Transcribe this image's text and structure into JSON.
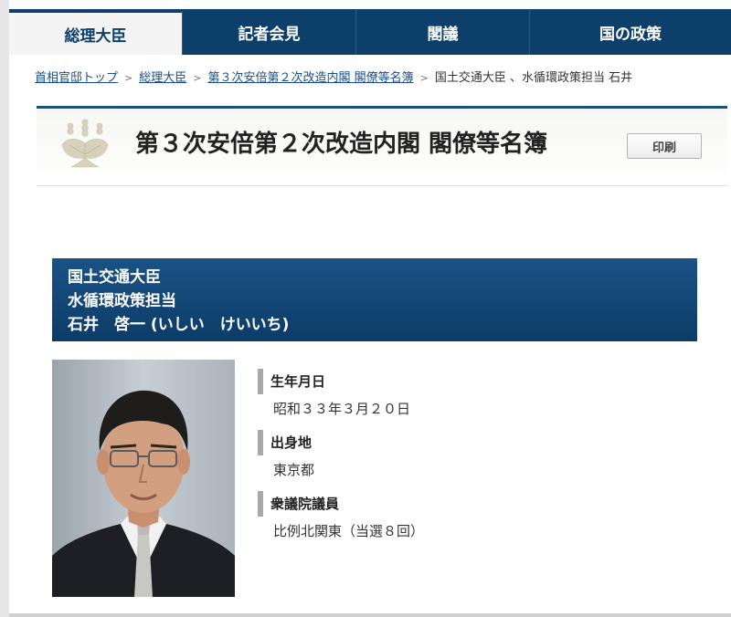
{
  "nav": {
    "items": [
      {
        "label": "総理大臣",
        "active": true
      },
      {
        "label": "記者会見",
        "active": false
      },
      {
        "label": "閣議",
        "active": false
      },
      {
        "label": "国の政策",
        "active": false
      }
    ]
  },
  "breadcrumb": {
    "items": [
      {
        "label": "首相官邸トップ",
        "link": true
      },
      {
        "label": "総理大臣",
        "link": true
      },
      {
        "label": "第３次安倍第２次改造内閣 閣僚等名簿",
        "link": true
      },
      {
        "label": "国土交通大臣 、水循環政策担当 石井",
        "link": false
      }
    ],
    "separator": ">"
  },
  "title_box": {
    "emblem": "paulownia-crest-icon",
    "title": "第３次安倍第２次改造内閣 閣僚等名簿",
    "print_label": "印刷"
  },
  "minister": {
    "post_1": "国土交通大臣",
    "post_2": "水循環政策担当",
    "name": "石井　啓一 (いしい　けいいち)"
  },
  "profile": {
    "birthdate_label": "生年月日",
    "birthdate": "昭和３３年３月２０日",
    "birthplace_label": "出身地",
    "birthplace": "東京都",
    "house_label": "衆議院議員",
    "house": "比例北関東（当選８回）"
  },
  "colors": {
    "nav_bg": "#0d3f6b",
    "header_bg": "#0c3c68",
    "link": "#1a4d8c"
  }
}
